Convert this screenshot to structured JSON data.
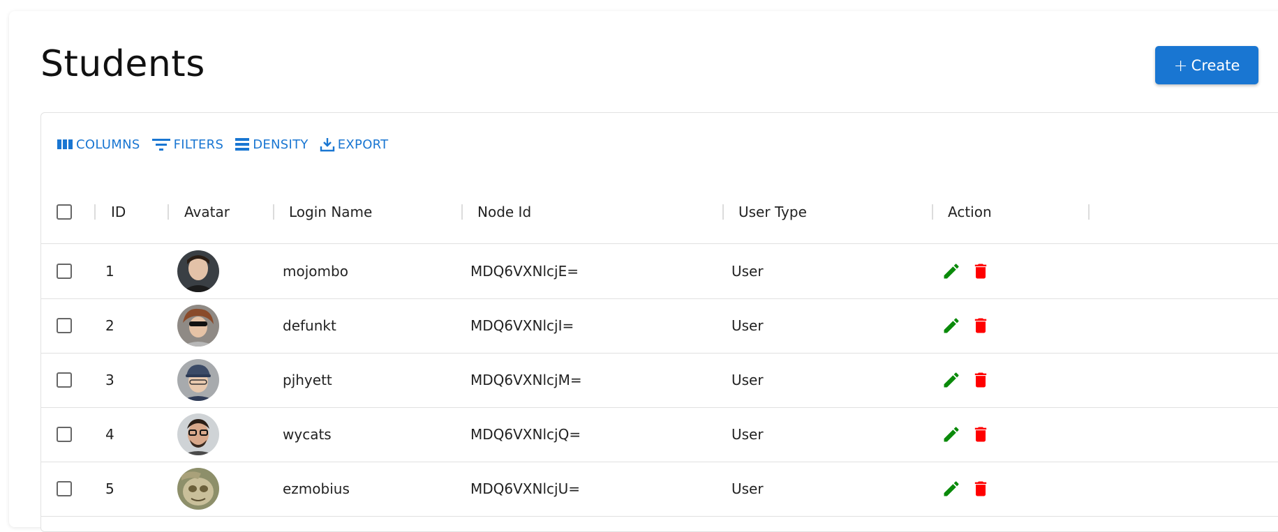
{
  "page": {
    "title": "Students"
  },
  "create_button": {
    "label": "Create",
    "icon": "plus-icon"
  },
  "toolbar": {
    "columns": "COLUMNS",
    "filters": "FILTERS",
    "density": "DENSITY",
    "export": "EXPORT"
  },
  "columns": {
    "id": "ID",
    "avatar": "Avatar",
    "login": "Login Name",
    "node": "Node Id",
    "type": "User Type",
    "action": "Action"
  },
  "rows": [
    {
      "id": "1",
      "login": "mojombo",
      "node": "MDQ6VXNlcjE=",
      "type": "User"
    },
    {
      "id": "2",
      "login": "defunkt",
      "node": "MDQ6VXNlcjI=",
      "type": "User"
    },
    {
      "id": "3",
      "login": "pjhyett",
      "node": "MDQ6VXNlcjM=",
      "type": "User"
    },
    {
      "id": "4",
      "login": "wycats",
      "node": "MDQ6VXNlcjQ=",
      "type": "User"
    },
    {
      "id": "5",
      "login": "ezmobius",
      "node": "MDQ6VXNlcjU=",
      "type": "User"
    }
  ],
  "colors": {
    "accent": "#1976d2",
    "edit": "#0a8a0a",
    "delete": "#ff0000"
  }
}
